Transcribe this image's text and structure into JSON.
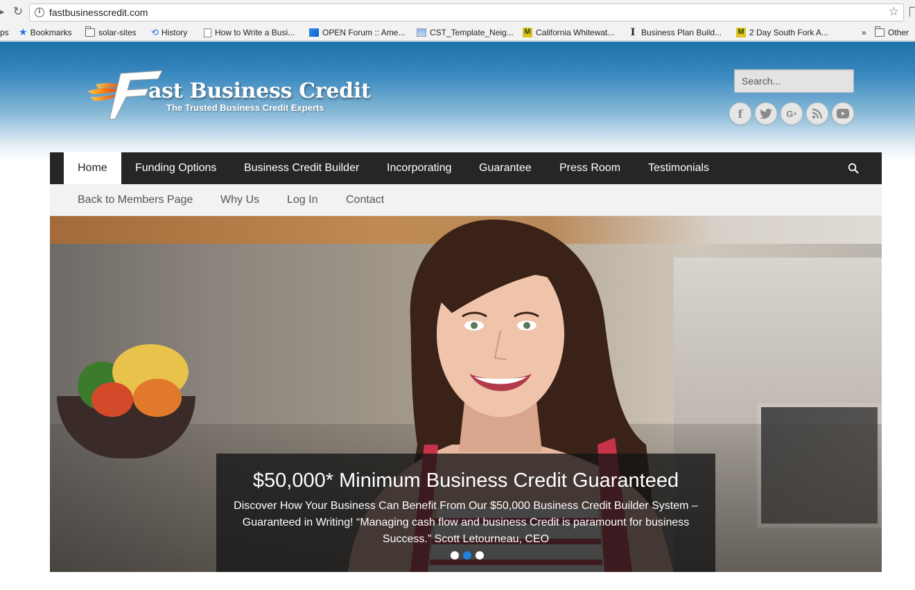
{
  "browser": {
    "url": "fastbusinesscredit.com",
    "bookmarks": [
      {
        "label": "ps",
        "icon": "apps-icon"
      },
      {
        "label": "Bookmarks",
        "icon": "star-icon"
      },
      {
        "label": "solar-sites",
        "icon": "folder-icon"
      },
      {
        "label": "History",
        "icon": "history-icon"
      },
      {
        "label": "How to Write a Busi...",
        "icon": "document-icon"
      },
      {
        "label": "OPEN Forum :: Ame...",
        "icon": "site-icon"
      },
      {
        "label": "CST_Template_Neig...",
        "icon": "image-file-icon"
      },
      {
        "label": "California Whitewat...",
        "icon": "m-icon"
      },
      {
        "label": "Business Plan Build...",
        "icon": "i-icon"
      },
      {
        "label": "2 Day South Fork A...",
        "icon": "m-icon"
      }
    ],
    "overflow": "»",
    "other": "Other"
  },
  "header": {
    "logo_title": "ast Business Credit",
    "logo_tagline": "The Trusted Business Credit Experts",
    "search_placeholder": "Search...",
    "social": [
      {
        "name": "facebook-icon",
        "glyph": "f"
      },
      {
        "name": "twitter-icon",
        "glyph": "t"
      },
      {
        "name": "google-plus-icon",
        "glyph": "G+"
      },
      {
        "name": "rss-icon",
        "glyph": "rss"
      },
      {
        "name": "youtube-icon",
        "glyph": "yt"
      }
    ]
  },
  "main_nav": [
    "Home",
    "Funding Options",
    "Business Credit Builder",
    "Incorporating",
    "Guarantee",
    "Press Room",
    "Testimonials"
  ],
  "sub_nav": [
    "Back to Members Page",
    "Why Us",
    "Log In",
    "Contact"
  ],
  "hero": {
    "title": "$50,000* Minimum Business Credit Guaranteed",
    "body": "Discover How Your Business Can Benefit From Our $50,000 Business Credit Builder System – Guaranteed in Writing! “Managing cash flow and business Credit is paramount for business Success.” Scott Letourneau, CEO",
    "slide_count": 3,
    "active_slide": 2
  },
  "colors": {
    "header_blue": "#1d70a8",
    "nav_dark": "#262626",
    "subnav_bg": "#f2f2f2",
    "active_dot": "#1e82d8"
  }
}
